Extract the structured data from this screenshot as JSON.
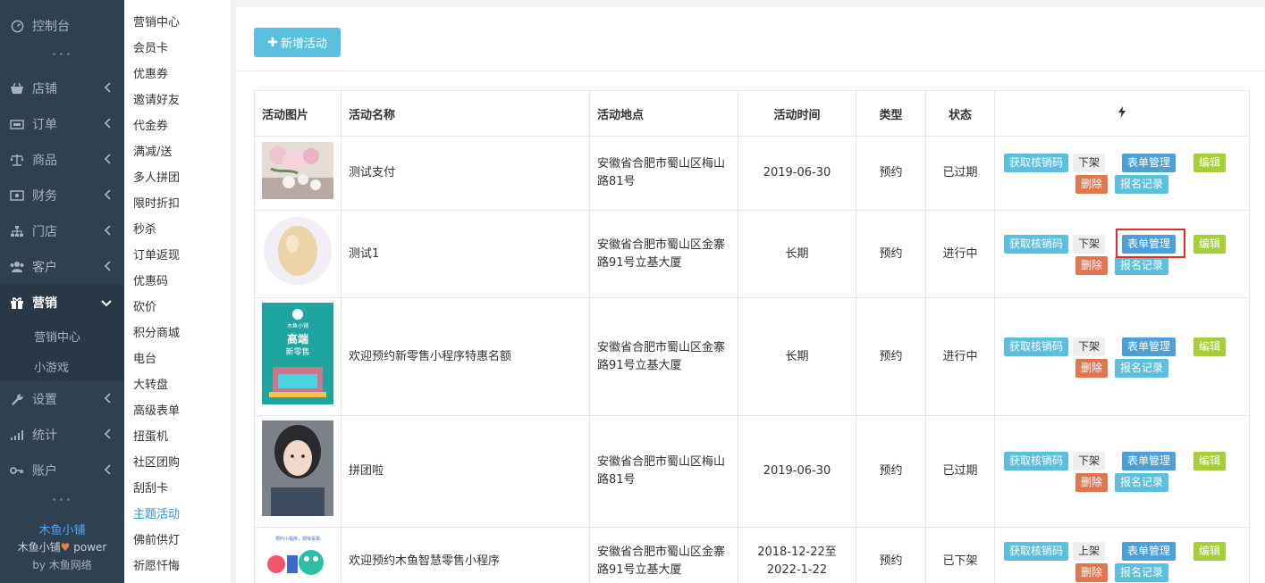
{
  "sidebar": {
    "items": [
      {
        "label": "控制台",
        "icon": "dashboard-icon"
      },
      {
        "label": "店铺",
        "icon": "shop-icon"
      },
      {
        "label": "订单",
        "icon": "order-icon"
      },
      {
        "label": "商品",
        "icon": "scale-icon"
      },
      {
        "label": "财务",
        "icon": "money-icon"
      },
      {
        "label": "门店",
        "icon": "sitemap-icon"
      },
      {
        "label": "客户",
        "icon": "users-icon"
      },
      {
        "label": "营销",
        "icon": "gift-icon"
      },
      {
        "label": "设置",
        "icon": "wrench-icon"
      },
      {
        "label": "统计",
        "icon": "bar-chart-icon"
      },
      {
        "label": "账户",
        "icon": "key-icon"
      }
    ],
    "marketing_sub": [
      "营销中心",
      "小游戏"
    ],
    "footer": {
      "brand": "木鱼小铺",
      "power_prefix": "木鱼小铺",
      "power_suffix": " power",
      "by": "by 木鱼网络"
    }
  },
  "submenu": {
    "items": [
      "营销中心",
      "会员卡",
      "优惠券",
      "邀请好友",
      "代金券",
      "满减/送",
      "多人拼团",
      "限时折扣",
      "秒杀",
      "订单返现",
      "优惠码",
      "砍价",
      "积分商城",
      "电台",
      "大转盘",
      "高级表单",
      "扭蛋机",
      "社区团购",
      "刮刮卡",
      "主题活动",
      "佛前供灯",
      "祈愿忏悔"
    ],
    "current_index": 19
  },
  "toolbar": {
    "add_label": "新增活动"
  },
  "table": {
    "headers": [
      "活动图片",
      "活动名称",
      "活动地点",
      "活动时间",
      "类型",
      "状态"
    ],
    "actions": {
      "verify": "获取核销码",
      "edit": "编辑",
      "form": "表单管理",
      "delete": "删除",
      "records": "报名记录"
    },
    "rows": [
      {
        "name": "测试支付",
        "location": "安徽省合肥市蜀山区梅山路81号",
        "time": "2019-06-30",
        "type": "预约",
        "status": "已过期",
        "status_kind": "expired",
        "shelf": "下架",
        "image": "flowers"
      },
      {
        "name": "测试1",
        "location": "安徽省合肥市蜀山区金寨路91号立基大厦",
        "time": "长期",
        "type": "预约",
        "status": "进行中",
        "status_kind": "active",
        "shelf": "下架",
        "image": "egg"
      },
      {
        "name": "欢迎预约新零售小程序特惠名额",
        "location": "安徽省合肥市蜀山区金寨路91号立基大厦",
        "time": "长期",
        "type": "预约",
        "status": "进行中",
        "status_kind": "active",
        "shelf": "下架",
        "image": "poster"
      },
      {
        "name": "拼团啦",
        "location": "安徽省合肥市蜀山区梅山路81号",
        "time": "2019-06-30",
        "type": "预约",
        "status": "已过期",
        "status_kind": "expired",
        "shelf": "下架",
        "image": "portrait"
      },
      {
        "name": "欢迎预约木鱼智慧零售小程序",
        "location": "安徽省合肥市蜀山区金寨路91号立基大厦",
        "time": "2018-12-22至2022-1-22",
        "type": "预约",
        "status": "已下架",
        "status_kind": "off",
        "shelf": "上架",
        "image": "promo"
      }
    ]
  },
  "poster": {
    "brand": "木鱼小铺",
    "title1": "高端",
    "title2": "新零售"
  },
  "promo": {
    "caption": "预约小程序，领惊喜靠"
  },
  "colors": {
    "sidebar_bg": "#2f4050",
    "info": "#5bc0de",
    "primary": "#4d9fd8",
    "success": "#a6ce39",
    "danger": "#e0764e",
    "alert_text": "#e04b4a"
  }
}
